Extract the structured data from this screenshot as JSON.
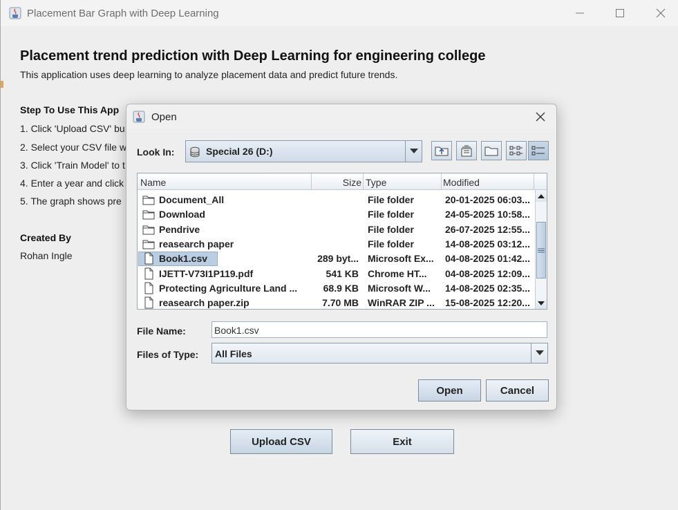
{
  "window": {
    "title": "Placement Bar Graph with Deep Learning"
  },
  "main": {
    "heading": "Placement trend prediction with Deep Learning for engineering college",
    "description": "This application uses deep learning to analyze placement data and predict future trends.",
    "steps_title": "Step To Use This App",
    "steps": [
      "1. Click 'Upload CSV' bu",
      "2. Select your CSV file w",
      "3. Click 'Train Model' to t",
      "4. Enter a year and click",
      "5. The graph shows pre"
    ],
    "created_title": "Created By",
    "created_name": "Rohan Ingle",
    "buttons": {
      "upload": "Upload CSV",
      "exit": "Exit"
    }
  },
  "dialog": {
    "title": "Open",
    "look_in_label": "Look In:",
    "look_in_value": "Special 26 (D:)",
    "columns": {
      "name": "Name",
      "size": "Size",
      "type": "Type",
      "modified": "Modified"
    },
    "files": [
      {
        "name": "Document_All",
        "size": "",
        "type": "File folder",
        "modified": "20-01-2025 06:03...",
        "icon": "folder"
      },
      {
        "name": "Download",
        "size": "",
        "type": "File folder",
        "modified": "24-05-2025 10:58...",
        "icon": "folder"
      },
      {
        "name": "Pendrive",
        "size": "",
        "type": "File folder",
        "modified": "26-07-2025 12:55...",
        "icon": "folder"
      },
      {
        "name": "reasearch paper",
        "size": "",
        "type": "File folder",
        "modified": "14-08-2025 03:12...",
        "icon": "folder"
      },
      {
        "name": "Book1.csv",
        "size": "289 byt...",
        "type": "Microsoft Ex...",
        "modified": "04-08-2025 01:42...",
        "icon": "file",
        "selected": true
      },
      {
        "name": "IJETT-V73I1P119.pdf",
        "size": "541 KB",
        "type": "Chrome HT...",
        "modified": "04-08-2025 12:09...",
        "icon": "file"
      },
      {
        "name": "Protecting Agriculture Land ...",
        "size": "68.9 KB",
        "type": "Microsoft W...",
        "modified": "14-08-2025 02:35...",
        "icon": "file"
      },
      {
        "name": "reasearch paper.zip",
        "size": "7.70 MB",
        "type": "WinRAR ZIP ...",
        "modified": "15-08-2025 12:20...",
        "icon": "file"
      }
    ],
    "file_name_label": "File Name:",
    "file_name_value": "Book1.csv",
    "files_of_type_label": "Files of Type:",
    "files_of_type_value": "All Files",
    "open_button": "Open",
    "cancel_button": "Cancel"
  }
}
